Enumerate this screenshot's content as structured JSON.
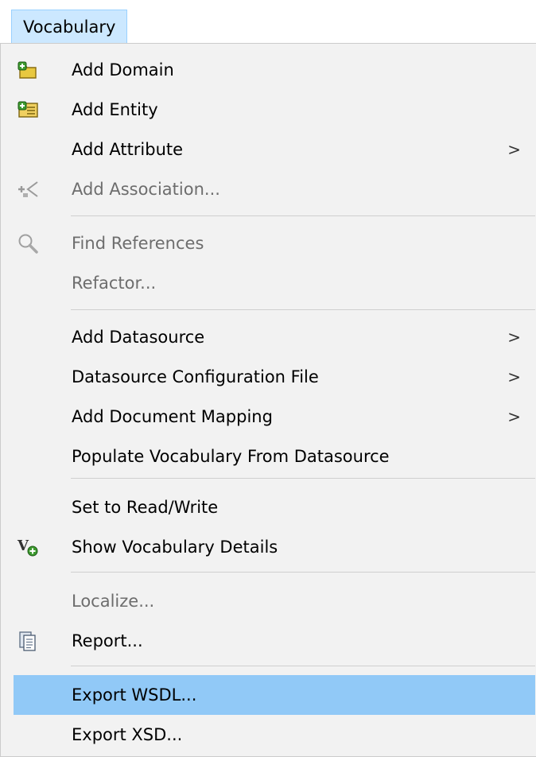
{
  "menubar": {
    "title": "Vocabulary"
  },
  "menu": {
    "items": [
      {
        "label": "Add Domain",
        "icon": "add-domain-icon"
      },
      {
        "label": "Add Entity",
        "icon": "add-entity-icon"
      },
      {
        "label": "Add Attribute",
        "submenu": ">"
      },
      {
        "label": "Add Association...",
        "icon": "add-association-icon",
        "disabled": true
      },
      {
        "label": "Find References",
        "icon": "find-references-icon",
        "disabled": true
      },
      {
        "label": "Refactor...",
        "disabled": true
      },
      {
        "label": "Add Datasource",
        "submenu": ">"
      },
      {
        "label": "Datasource Configuration File",
        "submenu": ">"
      },
      {
        "label": "Add Document Mapping",
        "submenu": ">"
      },
      {
        "label": "Populate Vocabulary From Datasource"
      },
      {
        "label": "Set to Read/Write"
      },
      {
        "label": "Show Vocabulary Details",
        "icon": "vocabulary-details-icon"
      },
      {
        "label": "Localize...",
        "disabled": true
      },
      {
        "label": "Report...",
        "icon": "report-icon"
      },
      {
        "label": "Export WSDL...",
        "highlighted": true
      },
      {
        "label": "Export XSD..."
      }
    ]
  },
  "colors": {
    "menubar_tab_bg": "#cce8ff",
    "menu_bg": "#f2f2f2",
    "highlight": "#91c9f7",
    "disabled_text": "#6d6d6d"
  }
}
